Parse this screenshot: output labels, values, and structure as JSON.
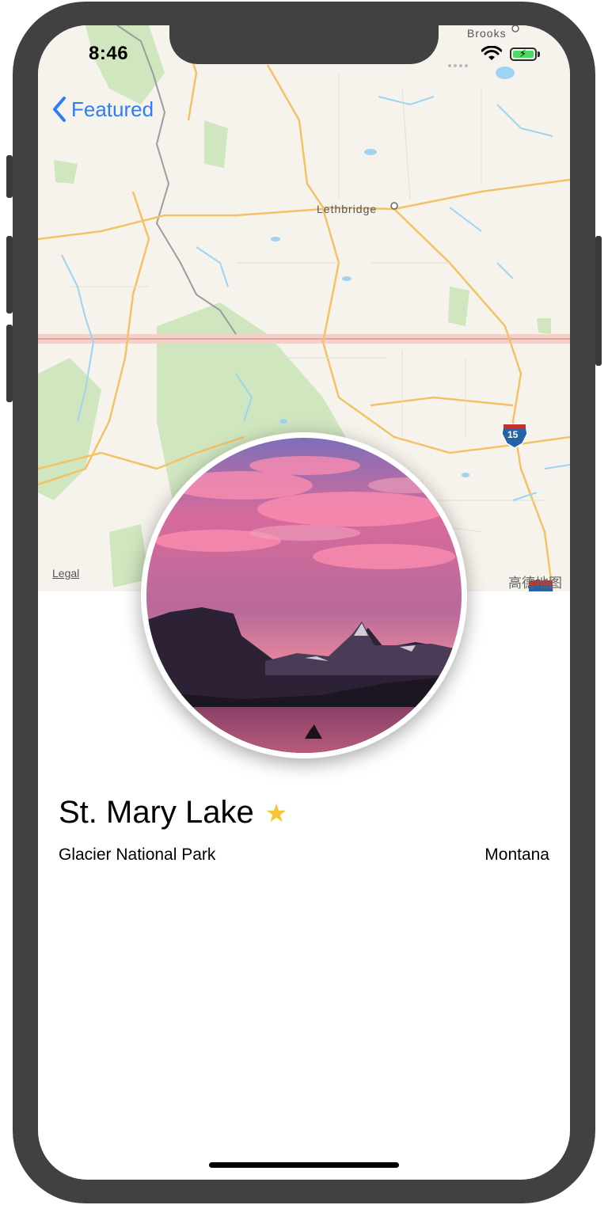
{
  "status_bar": {
    "time": "8:46"
  },
  "navigation": {
    "back_label": "Featured"
  },
  "map": {
    "labels": {
      "lethbridge": "Lethbridge",
      "brooks": "Brooks"
    },
    "legal": "Legal",
    "brand": "高德地图",
    "highway_shield": "15"
  },
  "landmark": {
    "name": "St. Mary Lake",
    "park": "Glacier National Park",
    "state": "Montana",
    "is_favorite": true
  },
  "colors": {
    "accent": "#2f7cf6",
    "favorite_star": "#f6c531",
    "map_background": "#f6f3ec",
    "road": "#f3c266",
    "park_green": "#cfe6bf",
    "border": "#f0b7b2"
  },
  "icons": [
    "chevron-left-icon",
    "star-icon",
    "wifi-icon",
    "battery-icon",
    "signal-icon"
  ]
}
